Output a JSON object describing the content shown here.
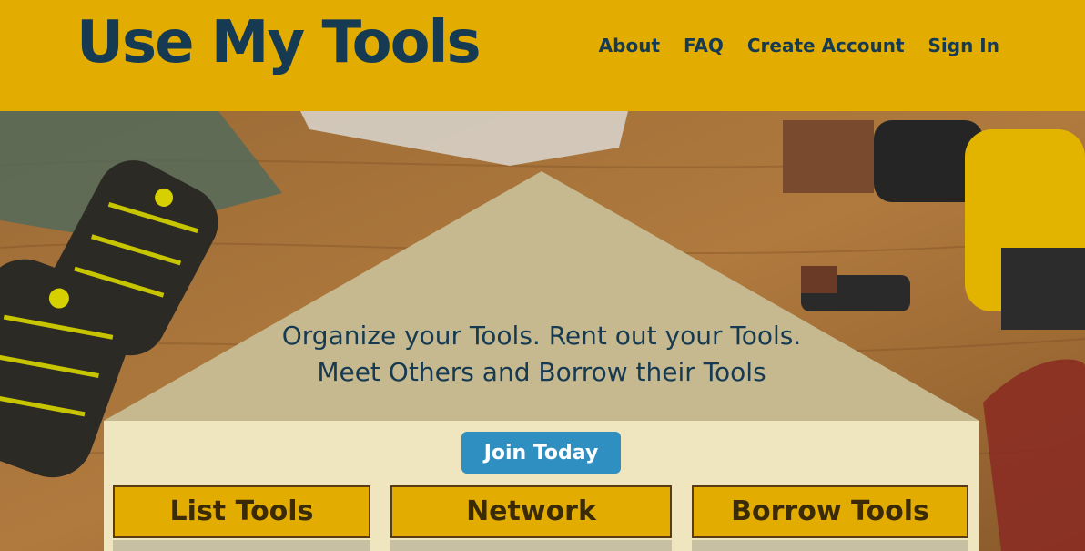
{
  "header": {
    "logo": "Use My Tools",
    "nav": [
      "About",
      "FAQ",
      "Create Account",
      "Sign In"
    ]
  },
  "hero": {
    "tagline_line1": "Organize your Tools. Rent out your Tools.",
    "tagline_line2": "Meet Others and Borrow their Tools",
    "join_label": "Join Today",
    "cards": [
      "List Tools",
      "Network",
      "Borrow Tools"
    ]
  },
  "colors": {
    "header_bg": "#e2ad00",
    "brand_text": "#163a52",
    "panel_bg": "#efe5bf",
    "roof_bg": "#c6b98f",
    "button": "#2f8fc0",
    "card_bg": "#e2ad00"
  }
}
